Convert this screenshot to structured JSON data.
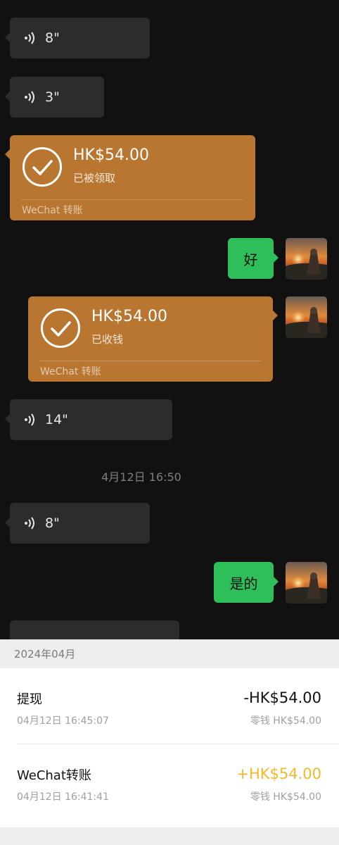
{
  "chat": {
    "messages": [
      {
        "type": "voice",
        "duration": "8\""
      },
      {
        "type": "voice",
        "duration": "3\""
      },
      {
        "type": "transfer",
        "amount": "HK$54.00",
        "status": "已被领取",
        "footer": "WeChat 转账"
      },
      {
        "type": "text",
        "text": "好"
      },
      {
        "type": "transfer",
        "amount": "HK$54.00",
        "status": "已收钱",
        "footer": "WeChat 转账"
      },
      {
        "type": "voice",
        "duration": "14\""
      },
      {
        "type": "timestamp",
        "text": "4月12日 16:50"
      },
      {
        "type": "voice",
        "duration": "8\""
      },
      {
        "type": "text",
        "text": "是的"
      }
    ]
  },
  "ledger": {
    "month": "2024年04月",
    "records": [
      {
        "title": "提现",
        "time": "04月12日 16:45:07",
        "amount": "-HK$54.00",
        "balance": "零钱 HK$54.00"
      },
      {
        "title": "WeChat转账",
        "time": "04月12日 16:41:41",
        "amount": "+HK$54.00",
        "balance": "零钱 HK$54.00"
      }
    ]
  },
  "colors": {
    "chat_bg": "#111111",
    "voice_bubble": "#2c2c2c",
    "transfer_bubble": "#b87631",
    "text_bubble": "#2fbf5a",
    "positive_amount": "#f2b92a"
  },
  "icons": {
    "voice": "voice-wave-icon",
    "transfer_status": "check-circle-icon"
  }
}
